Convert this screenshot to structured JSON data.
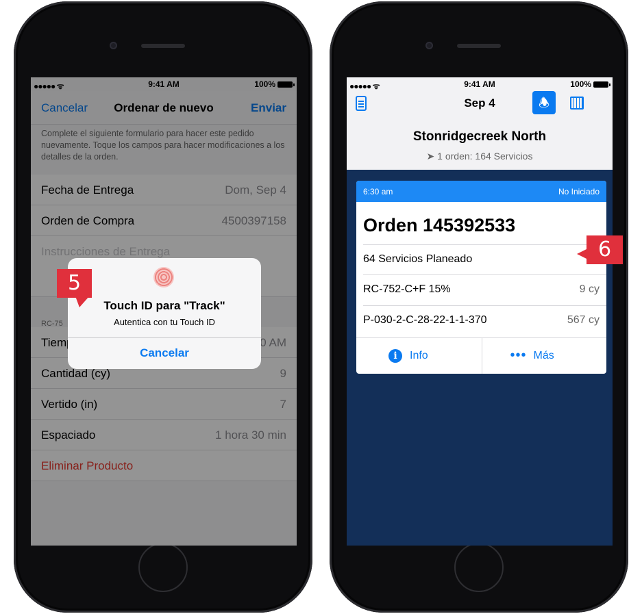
{
  "status": {
    "signal": "●●●●● ᯤ",
    "time": "9:41 AM",
    "battery": "100%"
  },
  "left": {
    "nav": {
      "cancel": "Cancelar",
      "title": "Ordenar de nuevo",
      "send": "Enviar"
    },
    "intro": "Complete el siguiente formulario para hacer este pedido nuevamente. Toque los campos para hacer modificaciones a los detalles de la orden.",
    "fields": [
      {
        "label": "Fecha de Entrega",
        "value": "Dom, Sep 4"
      },
      {
        "label": "Orden de Compra",
        "value": "4500397158"
      },
      {
        "label": "Instrucciones de Entrega",
        "value": ""
      }
    ],
    "section_label": "RC-75",
    "fields2": [
      {
        "label": "Tiempo de Entrega",
        "value": "6:30 AM"
      },
      {
        "label": "Cantidad (cy)",
        "value": "9"
      },
      {
        "label": "Vertido (in)",
        "value": "7"
      },
      {
        "label": "Espaciado",
        "value": "1 hora 30 min"
      }
    ],
    "delete": "Eliminar Producto",
    "alert": {
      "title": "Touch ID para \"Track\"",
      "message": "Autentica con tu Touch ID",
      "button": "Cancelar"
    },
    "callout": "5"
  },
  "right": {
    "date": "Sep 4",
    "site": "Stonridgecreek North",
    "summary": "1 orden: 164 Servicios",
    "card": {
      "time": "6:30 am",
      "state": "No Iniciado",
      "order": "Orden 145392533",
      "planned": "64 Servicios Planeado",
      "products": [
        {
          "name": "RC-752-C+F 15%",
          "qty": "9 cy"
        },
        {
          "name": "P-030-2-C-28-22-1-1-370",
          "qty": "567 cy"
        }
      ],
      "info": "Info",
      "more": "Más"
    },
    "callout": "6"
  },
  "colors": {
    "accent": "#0a7af0",
    "danger": "#e8392f",
    "callout": "#e0303c",
    "card_header": "#1d89f5",
    "background_dark": "#132f58"
  }
}
